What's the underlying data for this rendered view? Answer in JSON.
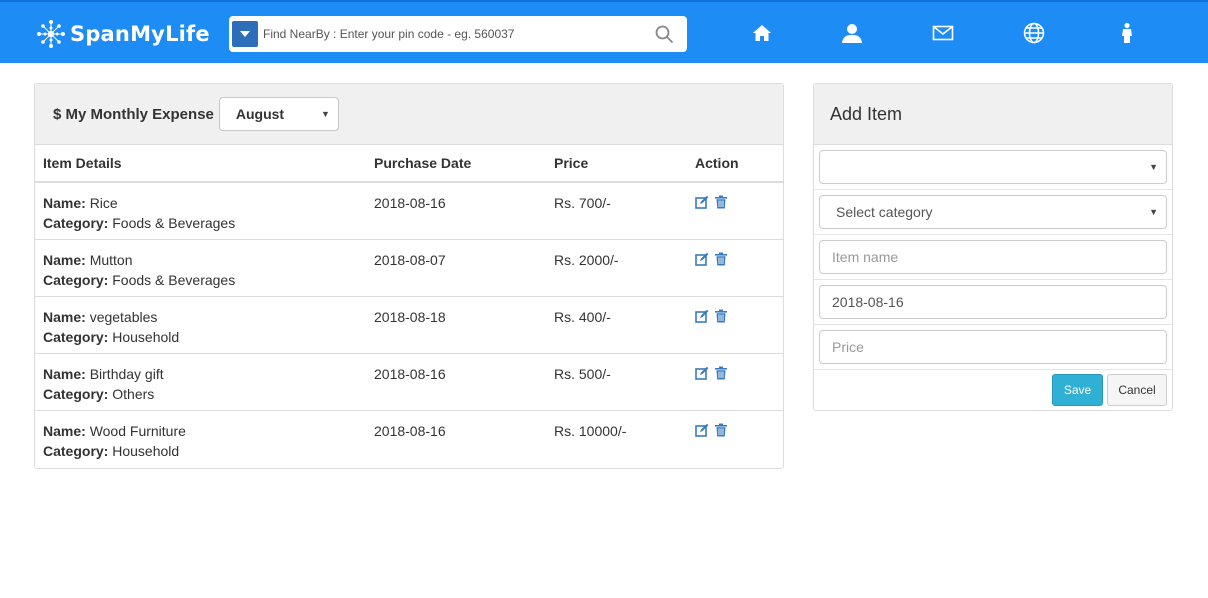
{
  "brand": {
    "name": "SpanMyLife",
    "logo_icon": "network-logo-icon"
  },
  "search": {
    "placeholder": "Find NearBy : Enter your pin code - eg. 560037",
    "dropdown_icon": "caret-down-icon",
    "search_icon": "magnifier-icon"
  },
  "nav": {
    "icons": [
      "home-icon",
      "user-icon",
      "mail-icon",
      "globe-icon",
      "person-icon"
    ]
  },
  "expense": {
    "currency_symbol": "$",
    "title": "My Monthly Expense",
    "month": "August",
    "columns": {
      "details": "Item Details",
      "date": "Purchase Date",
      "price": "Price",
      "action": "Action"
    },
    "name_label": "Name:",
    "category_label": "Category:",
    "rows": [
      {
        "name": "Rice",
        "category": "Foods & Beverages",
        "date": "2018-08-16",
        "price": "Rs. 700/-"
      },
      {
        "name": "Mutton",
        "category": "Foods & Beverages",
        "date": "2018-08-07",
        "price": "Rs. 2000/-"
      },
      {
        "name": "vegetables",
        "category": "Household",
        "date": "2018-08-18",
        "price": "Rs. 400/-"
      },
      {
        "name": "Birthday gift",
        "category": "Others",
        "date": "2018-08-16",
        "price": "Rs. 500/-"
      },
      {
        "name": "Wood Furniture",
        "category": "Household",
        "date": "2018-08-16",
        "price": "Rs. 10000/-"
      }
    ]
  },
  "add_item": {
    "title": "Add Item",
    "first_select_value": "",
    "category_placeholder": "Select category",
    "item_name_placeholder": "Item name",
    "date_value": "2018-08-16",
    "price_placeholder": "Price",
    "save_label": "Save",
    "cancel_label": "Cancel"
  },
  "colors": {
    "navbar": "#1e8cf5",
    "icon_blue": "#3a7bbf",
    "save_button": "#31b0d5"
  }
}
